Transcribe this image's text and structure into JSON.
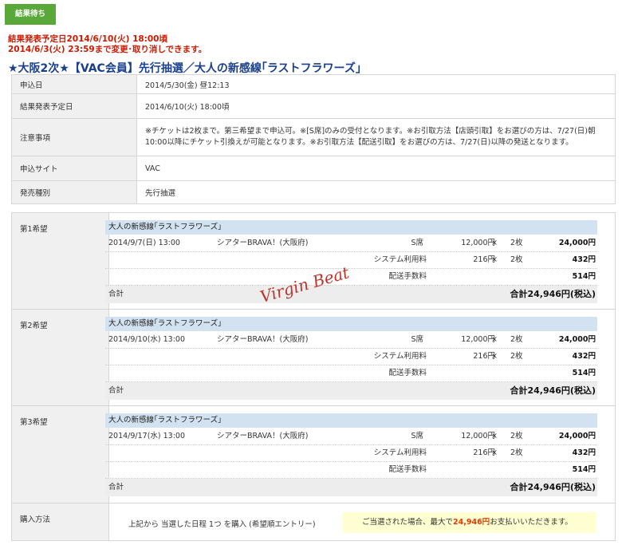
{
  "status_badge": "結果待ち",
  "notice": {
    "line1": "結果発表予定日2014/6/10(火) 18:00頃",
    "line2": "2014/6/3(火) 23:59まで変更･取り消しできます。"
  },
  "title": "★大阪2次★【VAC会員】先行抽選／大人の新感線｢ラストフラワーズ｣",
  "info": [
    {
      "label": "申込日",
      "value": "2014/5/30(金) 昼12:13"
    },
    {
      "label": "結果発表予定日",
      "value": "2014/6/10(火) 18:00頃"
    },
    {
      "label": "注意事項",
      "value": "※チケットは2枚まで。第三希望まで申込可。※[S席]のみの受付となります。※お引取方法【店頭引取】をお選びの方は、7/27(日)朝10:00以降にチケット引換えが可能となります。※お引取方法【配送引取】をお選びの方は、7/27(日)以降の発送となります。"
    },
    {
      "label": "申込サイト",
      "value": "VAC"
    },
    {
      "label": "発売種別",
      "value": "先行抽選"
    }
  ],
  "choices": [
    {
      "label": "第1希望",
      "title": "大人の新感線｢ラストフラワーズ｣",
      "date": "2014/9/7(日) 13:00",
      "venue": "シアターBRAVA！(大阪府)",
      "seat": "S席",
      "price": "12,000円",
      "times": "×",
      "qty": "2枚",
      "amount": "24,000円",
      "fee_label": "システム利用料",
      "fee_price": "216円",
      "fee_qty": "2枚",
      "fee_amount": "432円",
      "ship_label": "配送手数料",
      "ship_amount": "514円",
      "total_label": "合計",
      "total_value": "合計24,946円(税込)"
    },
    {
      "label": "第2希望",
      "title": "大人の新感線｢ラストフラワーズ｣",
      "date": "2014/9/10(水) 13:00",
      "venue": "シアターBRAVA！(大阪府)",
      "seat": "S席",
      "price": "12,000円",
      "times": "×",
      "qty": "2枚",
      "amount": "24,000円",
      "fee_label": "システム利用料",
      "fee_price": "216円",
      "fee_qty": "2枚",
      "fee_amount": "432円",
      "ship_label": "配送手数料",
      "ship_amount": "514円",
      "total_label": "合計",
      "total_value": "合計24,946円(税込)"
    },
    {
      "label": "第3希望",
      "title": "大人の新感線｢ラストフラワーズ｣",
      "date": "2014/9/17(水) 13:00",
      "venue": "シアターBRAVA！(大阪府)",
      "seat": "S席",
      "price": "12,000円",
      "times": "×",
      "qty": "2枚",
      "amount": "24,000円",
      "fee_label": "システム利用料",
      "fee_price": "216円",
      "fee_qty": "2枚",
      "fee_amount": "432円",
      "ship_label": "配送手数料",
      "ship_amount": "514円",
      "total_label": "合計",
      "total_value": "合計24,946円(税込)"
    }
  ],
  "purchase": {
    "label": "購入方法",
    "method": "上記から 当選した日程 1つ を購入 (希望順エントリー)",
    "pay_prefix": "ご当選された場合、最大で",
    "pay_amount": "24,946円",
    "pay_suffix": "お支払いいただきます。"
  },
  "watermark": "Virgin Beat"
}
